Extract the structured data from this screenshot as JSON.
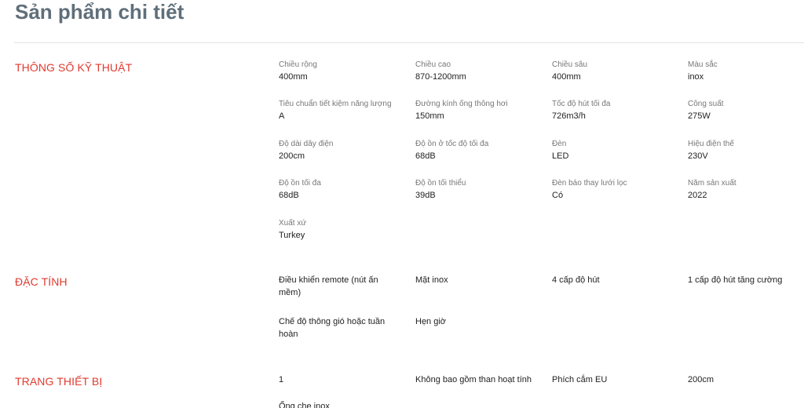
{
  "page": {
    "title": "Sản phẩm chi tiết"
  },
  "sections": {
    "specs": {
      "title": "THÔNG SỐ KỸ THUẬT",
      "items": [
        {
          "label": "Chiều rộng",
          "value": "400mm"
        },
        {
          "label": "Chiều cao",
          "value": "870-1200mm"
        },
        {
          "label": "Chiều sâu",
          "value": "400mm"
        },
        {
          "label": "Màu sắc",
          "value": "inox"
        },
        {
          "label": "Tiêu chuẩn tiết kiệm năng lượng",
          "value": "A"
        },
        {
          "label": "Đường kính ống thông hơi",
          "value": "150mm"
        },
        {
          "label": "Tốc độ hút tối đa",
          "value": "726m3/h"
        },
        {
          "label": "Công suất",
          "value": "275W"
        },
        {
          "label": "Độ dài dây điện",
          "value": "200cm"
        },
        {
          "label": "Độ ồn ở tốc độ tối đa",
          "value": "68dB"
        },
        {
          "label": "Đèn",
          "value": "LED"
        },
        {
          "label": "Hiệu điện thế",
          "value": "230V"
        },
        {
          "label": "Độ ồn tối đa",
          "value": "68dB"
        },
        {
          "label": "Độ ồn tối thiểu",
          "value": "39dB"
        },
        {
          "label": "Đèn báo thay lưới lọc",
          "value": "Có"
        },
        {
          "label": "Năm sản xuất",
          "value": "2022"
        },
        {
          "label": "Xuất xứ",
          "value": "Turkey"
        }
      ]
    },
    "features": {
      "title": "ĐẶC TÍNH",
      "items": [
        "Điều khiển remote (nút ấn mềm)",
        "Mặt inox",
        "4 cấp độ hút",
        "1 cấp độ hút tăng cường",
        "Chế độ thông gió hoặc tuần hoàn",
        "Hẹn giờ"
      ]
    },
    "equipment": {
      "title": "TRANG THIẾT BỊ",
      "items": [
        "1",
        "Không bao gồm than hoạt tính",
        "Phích cắm EU",
        "200cm",
        "Ống che inox"
      ]
    }
  }
}
